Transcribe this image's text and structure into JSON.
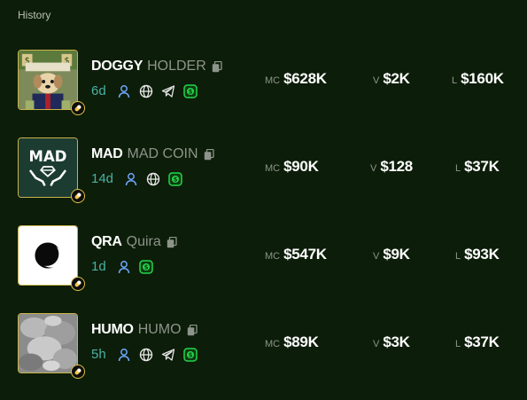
{
  "section_title": "History",
  "labels": {
    "mc": "MC",
    "v": "V",
    "l": "L"
  },
  "tokens": [
    {
      "ticker": "DOGGY",
      "name": "HOLDER",
      "age": "6d",
      "mc": "$628K",
      "v": "$2K",
      "l": "$160K",
      "links": [
        "user-icon",
        "globe-icon",
        "telegram-icon",
        "dollar-icon"
      ]
    },
    {
      "ticker": "MAD",
      "name": "MAD COIN",
      "age": "14d",
      "mc": "$90K",
      "v": "$128",
      "l": "$37K",
      "links": [
        "user-icon",
        "globe-icon",
        "dollar-icon"
      ],
      "logo_text": "MAD"
    },
    {
      "ticker": "QRA",
      "name": "Quira",
      "age": "1d",
      "mc": "$547K",
      "v": "$9K",
      "l": "$93K",
      "links": [
        "user-icon",
        "dollar-icon"
      ]
    },
    {
      "ticker": "HUMO",
      "name": "HUMO",
      "age": "5h",
      "mc": "$89K",
      "v": "$3K",
      "l": "$37K",
      "links": [
        "user-icon",
        "globe-icon",
        "telegram-icon",
        "dollar-icon"
      ]
    }
  ],
  "colors": {
    "background": "#0c1d09",
    "age": "#49b3a5",
    "border": "#c9b34a",
    "accent_green": "#22d64a"
  }
}
